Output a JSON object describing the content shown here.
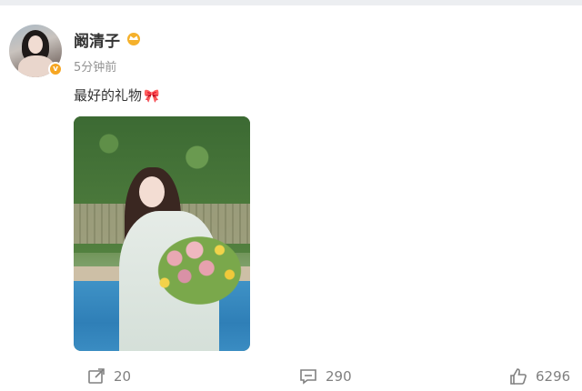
{
  "post": {
    "username": "阚清子",
    "time": "5分钟前",
    "text": "最好的礼物",
    "text_emoji": "🎀",
    "verified_badge": "v"
  },
  "actions": {
    "repost_count": "20",
    "comment_count": "290",
    "like_count": "6296"
  },
  "icons": [
    "crown-icon",
    "repost-icon",
    "comment-icon",
    "like-icon"
  ],
  "colors": {
    "verified": "#f6a623",
    "muted": "#939393",
    "text": "#333333"
  }
}
